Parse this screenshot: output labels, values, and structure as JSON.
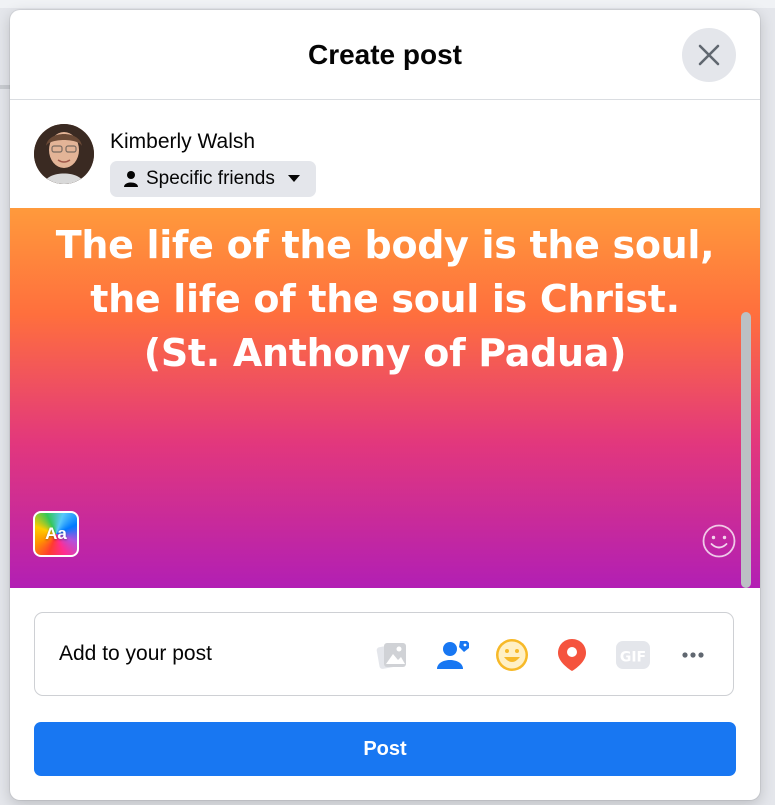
{
  "dialog": {
    "title": "Create post",
    "close_icon": "close-icon"
  },
  "author": {
    "name": "Kimberly Walsh",
    "audience_label": "Specific friends",
    "audience_icon": "person-icon"
  },
  "post": {
    "text_lines": [
      "The life of the body is the soul,",
      "the life of the soul is Christ.",
      "(St. Anthony of Padua)"
    ],
    "background_picker_label": "Aa",
    "gradient_colors": [
      "#ff9a3c",
      "#ff6f3d",
      "#e2377d",
      "#b21fb4"
    ]
  },
  "add_to_post": {
    "label": "Add to your post",
    "icons": [
      "photo-video-icon",
      "tag-people-icon",
      "feeling-icon",
      "location-icon",
      "gif-icon",
      "more-icon"
    ]
  },
  "post_button": {
    "label": "Post",
    "color": "#1877f2"
  }
}
